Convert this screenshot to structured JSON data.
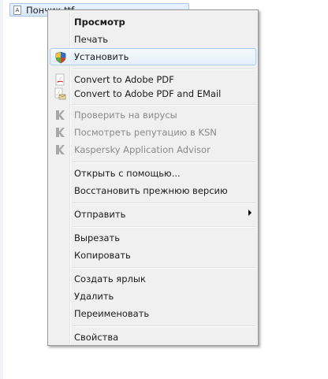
{
  "file": {
    "name": "Пончик.ttf",
    "icon": "font-file-icon"
  },
  "menu": {
    "preview": "Просмотр",
    "print": "Печать",
    "install": "Установить",
    "convert_pdf": "Convert to Adobe PDF",
    "convert_pdf_email": "Convert to Adobe PDF and EMail",
    "scan_virus": "Проверить на вирусы",
    "ksn_reputation": "Посмотреть репутацию в KSN",
    "kaspersky_advisor": "Kaspersky Application Advisor",
    "open_with": "Открыть с помощью...",
    "restore_previous": "Восстановить прежнюю версию",
    "send_to": "Отправить",
    "cut": "Вырезать",
    "copy": "Копировать",
    "create_shortcut": "Создать ярлык",
    "delete": "Удалить",
    "rename": "Переименовать",
    "properties": "Свойства"
  },
  "colors": {
    "hover_border": "#aecff7",
    "menu_bg": "#f0f0f0",
    "disabled_text": "#8a8a8a"
  }
}
